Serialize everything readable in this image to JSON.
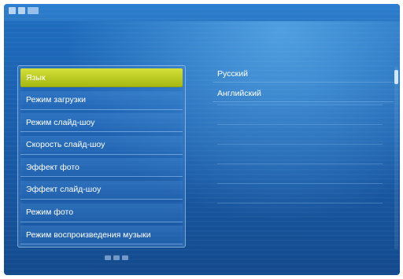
{
  "menu": {
    "items": [
      {
        "label": "Язык",
        "selected": true
      },
      {
        "label": "Режим загрузки",
        "selected": false
      },
      {
        "label": "Режим слайд-шоу",
        "selected": false
      },
      {
        "label": "Скорость слайд-шоу",
        "selected": false
      },
      {
        "label": "Эффект фото",
        "selected": false
      },
      {
        "label": "Эффект слайд-шоу",
        "selected": false
      },
      {
        "label": "Режим фото",
        "selected": false
      },
      {
        "label": "Режим воспроизведения музыки",
        "selected": false
      }
    ]
  },
  "options": {
    "items": [
      {
        "label": "Русский"
      },
      {
        "label": "Английский"
      }
    ]
  },
  "colors": {
    "background": "#1b5fae",
    "selected_highlight": "#c4d22c",
    "text": "#ffffff"
  },
  "icons": {
    "top_bar": [
      "status-icon",
      "status-icon",
      "status-icon"
    ],
    "bottom": "navigation-hint-icon"
  }
}
